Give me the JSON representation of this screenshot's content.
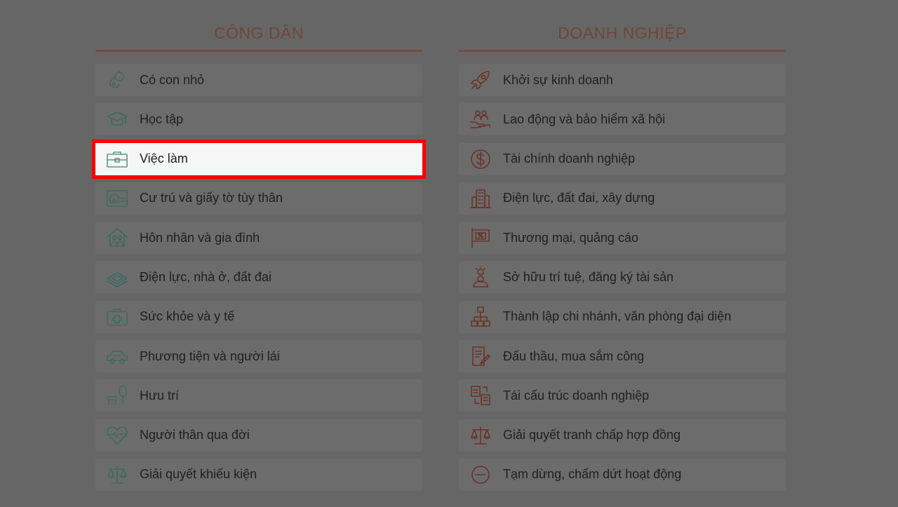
{
  "citizen": {
    "title": "CÔNG DÂN",
    "items": [
      {
        "label": "Có con nhỏ",
        "icon": "baby-icon"
      },
      {
        "label": "Học tập",
        "icon": "graduation-cap-icon"
      },
      {
        "label": "Việc làm",
        "icon": "briefcase-icon",
        "active": true
      },
      {
        "label": "Cư trú và giấy tờ tùy thân",
        "icon": "id-card-icon"
      },
      {
        "label": "Hôn nhân và gia đình",
        "icon": "family-home-icon"
      },
      {
        "label": "Điện lực, nhà ở, đất đai",
        "icon": "land-icon"
      },
      {
        "label": "Sức khỏe và y tế",
        "icon": "medical-kit-icon"
      },
      {
        "label": "Phương tiện và người lái",
        "icon": "car-icon"
      },
      {
        "label": "Hưu trí",
        "icon": "bench-tree-icon"
      },
      {
        "label": "Người thân qua đời",
        "icon": "heart-pulse-icon"
      },
      {
        "label": "Giải quyết khiếu kiện",
        "icon": "scales-icon"
      }
    ]
  },
  "business": {
    "title": "DOANH NGHIỆP",
    "items": [
      {
        "label": "Khởi sự kinh doanh",
        "icon": "rocket-icon"
      },
      {
        "label": "Lao động và bảo hiểm xã hội",
        "icon": "hand-people-icon"
      },
      {
        "label": "Tài chính doanh nghiệp",
        "icon": "dollar-icon"
      },
      {
        "label": "Điện lực, đất đai, xây dựng",
        "icon": "building-icon"
      },
      {
        "label": "Thương mại, quảng cáo",
        "icon": "billboard-icon"
      },
      {
        "label": "Sở hữu trí tuệ, đăng ký tài sản",
        "icon": "idea-person-icon"
      },
      {
        "label": "Thành lập chi nhánh, văn phòng đại diện",
        "icon": "org-chart-icon"
      },
      {
        "label": "Đấu thầu, mua sắm công",
        "icon": "document-pen-icon"
      },
      {
        "label": "Tái cấu trúc doanh nghiệp",
        "icon": "restructure-icon"
      },
      {
        "label": "Giải quyết tranh chấp hợp đồng",
        "icon": "scales-icon"
      },
      {
        "label": "Tạm dừng, chấm dứt hoạt động",
        "icon": "stop-icon"
      }
    ]
  }
}
